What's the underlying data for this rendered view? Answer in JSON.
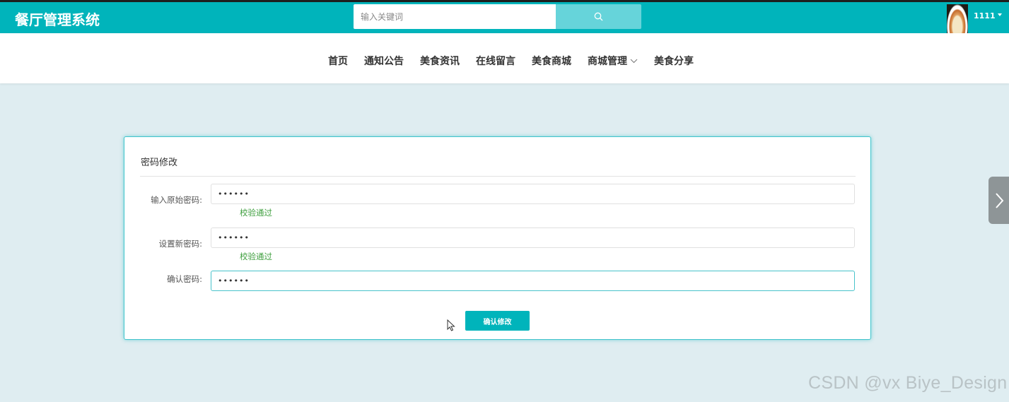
{
  "header": {
    "brand": "餐厅管理系统",
    "search_placeholder": "输入关键词",
    "search_icon": "search-icon",
    "user_name": "1111"
  },
  "nav": {
    "items": [
      "首页",
      "通知公告",
      "美食资讯",
      "在线留言",
      "美食商城",
      "商城管理",
      "美食分享"
    ]
  },
  "form": {
    "title": "密码修改",
    "fields": [
      {
        "label": "输入原始密码:",
        "value": "••••••",
        "validation": "校验通过"
      },
      {
        "label": "设置新密码:",
        "value": "••••••",
        "validation": "校验通过"
      },
      {
        "label": "确认密码:",
        "value": "••••••"
      }
    ],
    "submit_label": "确认修改"
  },
  "colors": {
    "primary": "#00b4bb",
    "valid": "#3f9f3f",
    "background": "#dfedf1"
  },
  "watermark": "CSDN @vx Biye_Design"
}
